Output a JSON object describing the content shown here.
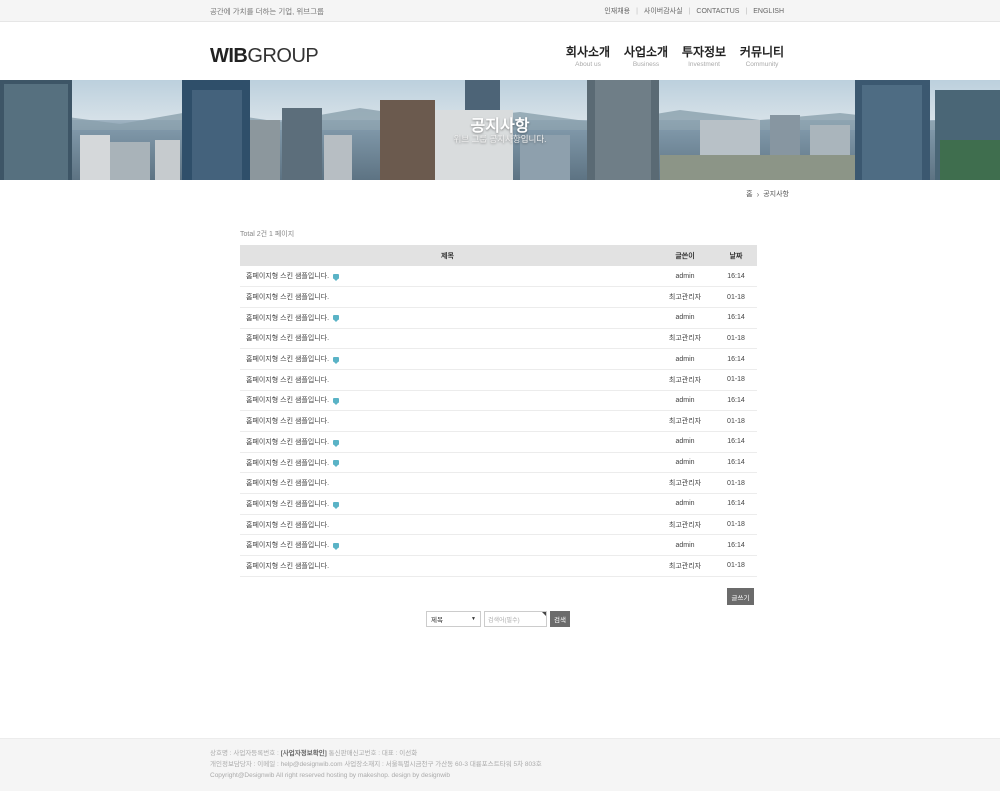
{
  "topbar": {
    "tagline": "공간에 가치를 더하는 기업, 위브그룹",
    "links": [
      "인재채용",
      "사이버감사실",
      "CONTACTUS",
      "ENGLISH"
    ]
  },
  "logo": {
    "bold": "WIB",
    "light": "GROUP"
  },
  "gnb": [
    {
      "ko": "회사소개",
      "en": "About us"
    },
    {
      "ko": "사업소개",
      "en": "Business"
    },
    {
      "ko": "투자정보",
      "en": "Investment"
    },
    {
      "ko": "커뮤니티",
      "en": "Community"
    }
  ],
  "hero": {
    "title": "공지사항",
    "subtitle": "위브 그룹 공지사항입니다."
  },
  "breadcrumb": {
    "home": "홈",
    "current": "공지사항"
  },
  "board": {
    "total": "Total 2건 1 페이지",
    "headers": {
      "subject": "제목",
      "writer": "글쓴이",
      "date": "날짜"
    },
    "rows": [
      {
        "subject": "홈페이지형 스킨 샘플입니다.",
        "comment": true,
        "writer": "admin",
        "date": "16:14"
      },
      {
        "subject": "홈페이지형 스킨 샘플입니다.",
        "comment": false,
        "writer": "최고관리자",
        "date": "01-18"
      },
      {
        "subject": "홈페이지형 스킨 샘플입니다.",
        "comment": true,
        "writer": "admin",
        "date": "16:14"
      },
      {
        "subject": "홈페이지형 스킨 샘플입니다.",
        "comment": false,
        "writer": "최고관리자",
        "date": "01-18"
      },
      {
        "subject": "홈페이지형 스킨 샘플입니다.",
        "comment": true,
        "writer": "admin",
        "date": "16:14"
      },
      {
        "subject": "홈페이지형 스킨 샘플입니다.",
        "comment": false,
        "writer": "최고관리자",
        "date": "01-18"
      },
      {
        "subject": "홈페이지형 스킨 샘플입니다.",
        "comment": true,
        "writer": "admin",
        "date": "16:14"
      },
      {
        "subject": "홈페이지형 스킨 샘플입니다.",
        "comment": false,
        "writer": "최고관리자",
        "date": "01-18"
      },
      {
        "subject": "홈페이지형 스킨 샘플입니다.",
        "comment": true,
        "writer": "admin",
        "date": "16:14"
      },
      {
        "subject": "홈페이지형 스킨 샘플입니다.",
        "comment": true,
        "writer": "admin",
        "date": "16:14"
      },
      {
        "subject": "홈페이지형 스킨 샘플입니다.",
        "comment": false,
        "writer": "최고관리자",
        "date": "01-18"
      },
      {
        "subject": "홈페이지형 스킨 샘플입니다.",
        "comment": true,
        "writer": "admin",
        "date": "16:14"
      },
      {
        "subject": "홈페이지형 스킨 샘플입니다.",
        "comment": false,
        "writer": "최고관리자",
        "date": "01-18"
      },
      {
        "subject": "홈페이지형 스킨 샘플입니다.",
        "comment": true,
        "writer": "admin",
        "date": "16:14"
      },
      {
        "subject": "홈페이지형 스킨 샘플입니다.",
        "comment": false,
        "writer": "최고관리자",
        "date": "01-18"
      }
    ],
    "write_label": "글쓰기"
  },
  "search": {
    "select_value": "제목",
    "input_placeholder": "검색어(필수)",
    "button_label": "검색"
  },
  "footer": {
    "line1_a": "상호명 : 사업자등록번호 : ",
    "line1_b": "[사업자정보확인]",
    "line1_c": " 통신판매신고번호 : 대표 : 이선화",
    "line2": "개인정보담당자 : 이메일 : help@designwib.com 사업장소재지 : 서울특별시금천구 가산동 60-3 대륭포스트타워 5차 803호",
    "line3": "Copyright@Designwib All right reserved hosting by makeshop. design by designwib"
  },
  "colors": {
    "comment_icon": "#5ab3c6",
    "button_bg": "#6b6b6b",
    "table_header_bg": "#e2e2e2"
  }
}
